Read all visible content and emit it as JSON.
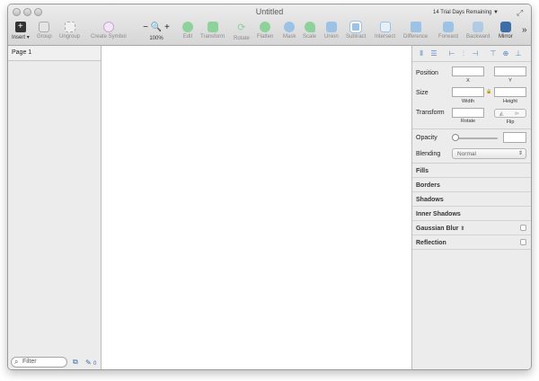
{
  "window": {
    "title": "Untitled",
    "trial_label": "14 Trial Days Remaining",
    "trial_arrow": "▼",
    "more": "»"
  },
  "toolbar": {
    "insert": "Insert",
    "group": "Group",
    "ungroup": "Ungroup",
    "create_symbol": "Create Symbol",
    "zoom_minus": "−",
    "zoom_plus": "+",
    "zoom_level": "100%",
    "edit": "Edit",
    "transform": "Transform",
    "rotate": "Rotate",
    "flatten": "Flatten",
    "mask": "Mask",
    "scale": "Scale",
    "union": "Union",
    "subtract": "Subtract",
    "intersect": "Intersect",
    "difference": "Difference",
    "forward": "Forward",
    "backward": "Backward",
    "mirror": "Mirror"
  },
  "layers": {
    "page_name": "Page 1",
    "filter_placeholder": "Filter",
    "count": "0"
  },
  "inspector": {
    "position": "Position",
    "x": "X",
    "y": "Y",
    "size": "Size",
    "width": "Width",
    "height": "Height",
    "lock": "🔒",
    "transform": "Transform",
    "rotate": "Rotate",
    "flip": "Flip",
    "opacity": "Opacity",
    "blending": "Blending",
    "blending_value": "Normal",
    "sections": [
      "Fills",
      "Borders",
      "Shadows",
      "Inner Shadows",
      "Gaussian Blur",
      "Reflection"
    ]
  },
  "colors": {
    "accent_blue": "#5a86c0",
    "toolbar_green": "#6fbf7a",
    "toolbar_blue": "#6fa6d6"
  }
}
